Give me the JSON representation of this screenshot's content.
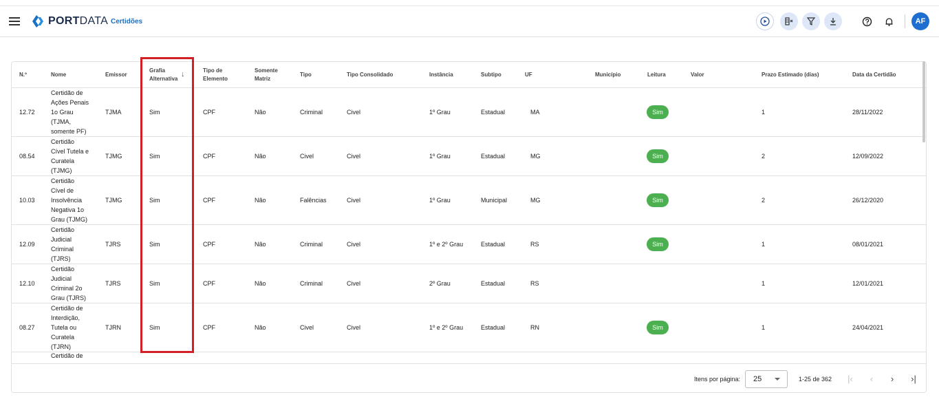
{
  "header": {
    "logo_port": "PORT",
    "logo_data": "DATA",
    "breadcrumb": "Certidões",
    "avatar": "AF",
    "icons": [
      "play-circle-icon",
      "column-toggle-icon",
      "filter-icon",
      "download-icon",
      "help-icon",
      "bell-icon"
    ]
  },
  "table": {
    "columns": [
      "N.º",
      "Nome",
      "Emissor",
      "Grafia Alternativa",
      "Tipo de Elemento",
      "Somente Matriz",
      "Tipo",
      "Tipo Consolidado",
      "Instância",
      "Subtipo",
      "UF",
      "Município",
      "Leitura",
      "Valor",
      "Prazo Estimado (dias)",
      "Data da Certidão"
    ],
    "column_lines": {
      "grafia": [
        "Grafia",
        "Alternativa"
      ],
      "tipo_elemento": [
        "Tipo de",
        "Elemento"
      ],
      "somente_matriz": [
        "Somente",
        "Matriz"
      ]
    },
    "rows": [
      {
        "num": "12.72",
        "nome": [
          "Certidão de",
          "Ações Penais",
          "1o Grau",
          "(TJMA,",
          "somente PF)"
        ],
        "emissor": "TJMA",
        "grafia": "Sim",
        "tipo_elemento": "CPF",
        "somente_matriz": "Não",
        "tipo": "Criminal",
        "tipo_consolidado": "Civel",
        "instancia": "1º Grau",
        "subtipo": "Estadual",
        "uf": "MA",
        "municipio": "",
        "leitura": "Sim",
        "valor": "",
        "prazo": "1",
        "data": "28/11/2022"
      },
      {
        "num": "08.54",
        "nome": [
          "Certidão",
          "Cível Tutela e",
          "Curatela",
          "(TJMG)"
        ],
        "emissor": "TJMG",
        "grafia": "Sim",
        "tipo_elemento": "CPF",
        "somente_matriz": "Não",
        "tipo": "Civel",
        "tipo_consolidado": "Civel",
        "instancia": "1º Grau",
        "subtipo": "Estadual",
        "uf": "MG",
        "municipio": "",
        "leitura": "Sim",
        "valor": "",
        "prazo": "2",
        "data": "12/09/2022"
      },
      {
        "num": "10.03",
        "nome": [
          "Certidão",
          "Cível de",
          "Insolvência",
          "Negativa 1o",
          "Grau (TJMG)"
        ],
        "emissor": "TJMG",
        "grafia": "Sim",
        "tipo_elemento": "CPF",
        "somente_matriz": "Não",
        "tipo": "Falências",
        "tipo_consolidado": "Civel",
        "instancia": "1º Grau",
        "subtipo": "Municipal",
        "uf": "MG",
        "municipio": "",
        "leitura": "Sim",
        "valor": "",
        "prazo": "2",
        "data": "26/12/2020"
      },
      {
        "num": "12.09",
        "nome": [
          "Certidão",
          "Judicial",
          "Criminal",
          "(TJRS)"
        ],
        "emissor": "TJRS",
        "grafia": "Sim",
        "tipo_elemento": "CPF",
        "somente_matriz": "Não",
        "tipo": "Criminal",
        "tipo_consolidado": "Civel",
        "instancia": "1º e 2º Grau",
        "subtipo": "Estadual",
        "uf": "RS",
        "municipio": "",
        "leitura": "Sim",
        "valor": "",
        "prazo": "1",
        "data": "08/01/2021"
      },
      {
        "num": "12.10",
        "nome": [
          "Certidão",
          "Judicial",
          "Criminal 2o",
          "Grau (TJRS)"
        ],
        "emissor": "TJRS",
        "grafia": "Sim",
        "tipo_elemento": "CPF",
        "somente_matriz": "Não",
        "tipo": "Criminal",
        "tipo_consolidado": "Civel",
        "instancia": "2º Grau",
        "subtipo": "Estadual",
        "uf": "RS",
        "municipio": "",
        "leitura": "",
        "valor": "",
        "prazo": "1",
        "data": "12/01/2021"
      },
      {
        "num": "08.27",
        "nome": [
          "Certidão de",
          "Interdição,",
          "Tutela ou",
          "Curatela",
          "(TJRN)"
        ],
        "emissor": "TJRN",
        "grafia": "Sim",
        "tipo_elemento": "CPF",
        "somente_matriz": "Não",
        "tipo": "Civel",
        "tipo_consolidado": "Civel",
        "instancia": "1º e 2º Grau",
        "subtipo": "Estadual",
        "uf": "RN",
        "municipio": "",
        "leitura": "Sim",
        "valor": "",
        "prazo": "1",
        "data": "24/04/2021"
      }
    ],
    "partial_row_text": "Certidão de"
  },
  "pagination": {
    "items_per_page_label": "Itens por página:",
    "items_per_page_value": "25",
    "range_label": "1-25 de 362"
  }
}
